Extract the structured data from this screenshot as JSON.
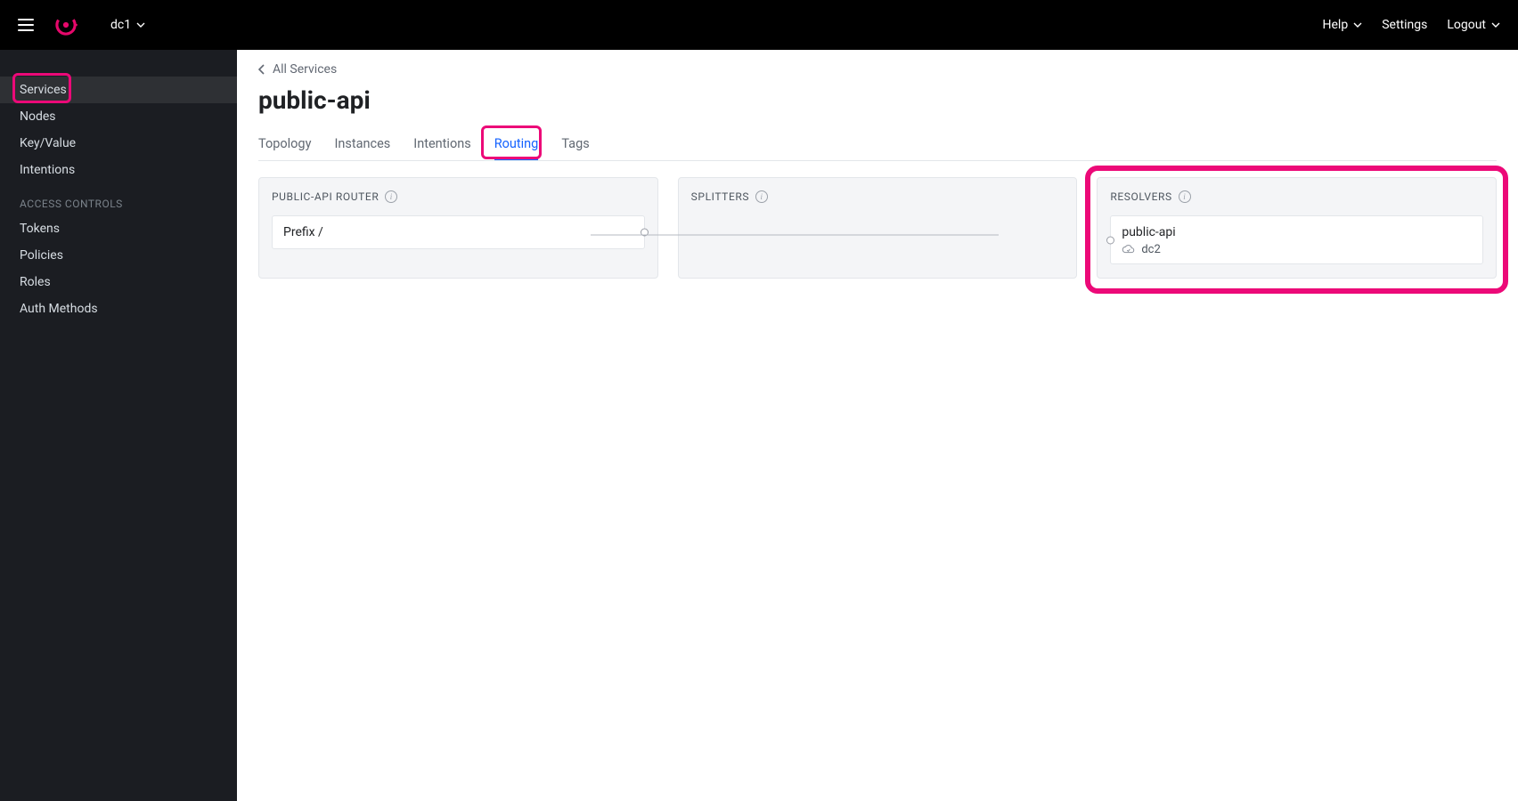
{
  "topbar": {
    "datacenter": "dc1",
    "nav": {
      "help": "Help",
      "settings": "Settings",
      "logout": "Logout"
    }
  },
  "sidebar": {
    "items": [
      {
        "label": "Services",
        "active": true
      },
      {
        "label": "Nodes"
      },
      {
        "label": "Key/Value"
      },
      {
        "label": "Intentions"
      }
    ],
    "access_label": "ACCESS CONTROLS",
    "access_items": [
      {
        "label": "Tokens"
      },
      {
        "label": "Policies"
      },
      {
        "label": "Roles"
      },
      {
        "label": "Auth Methods"
      }
    ]
  },
  "breadcrumb": {
    "back_label": "All Services"
  },
  "page_title": "public-api",
  "tabs": [
    {
      "label": "Topology"
    },
    {
      "label": "Instances"
    },
    {
      "label": "Intentions"
    },
    {
      "label": "Routing",
      "active": true
    },
    {
      "label": "Tags"
    }
  ],
  "routing": {
    "router_panel_title": "PUBLIC-API ROUTER",
    "splitters_panel_title": "SPLITTERS",
    "resolvers_panel_title": "RESOLVERS",
    "route_rule": "Prefix /",
    "resolver": {
      "name": "public-api",
      "redirect_dc": "dc2"
    }
  },
  "highlights": {
    "services": true,
    "routing_tab": true,
    "resolvers_panel": true
  }
}
